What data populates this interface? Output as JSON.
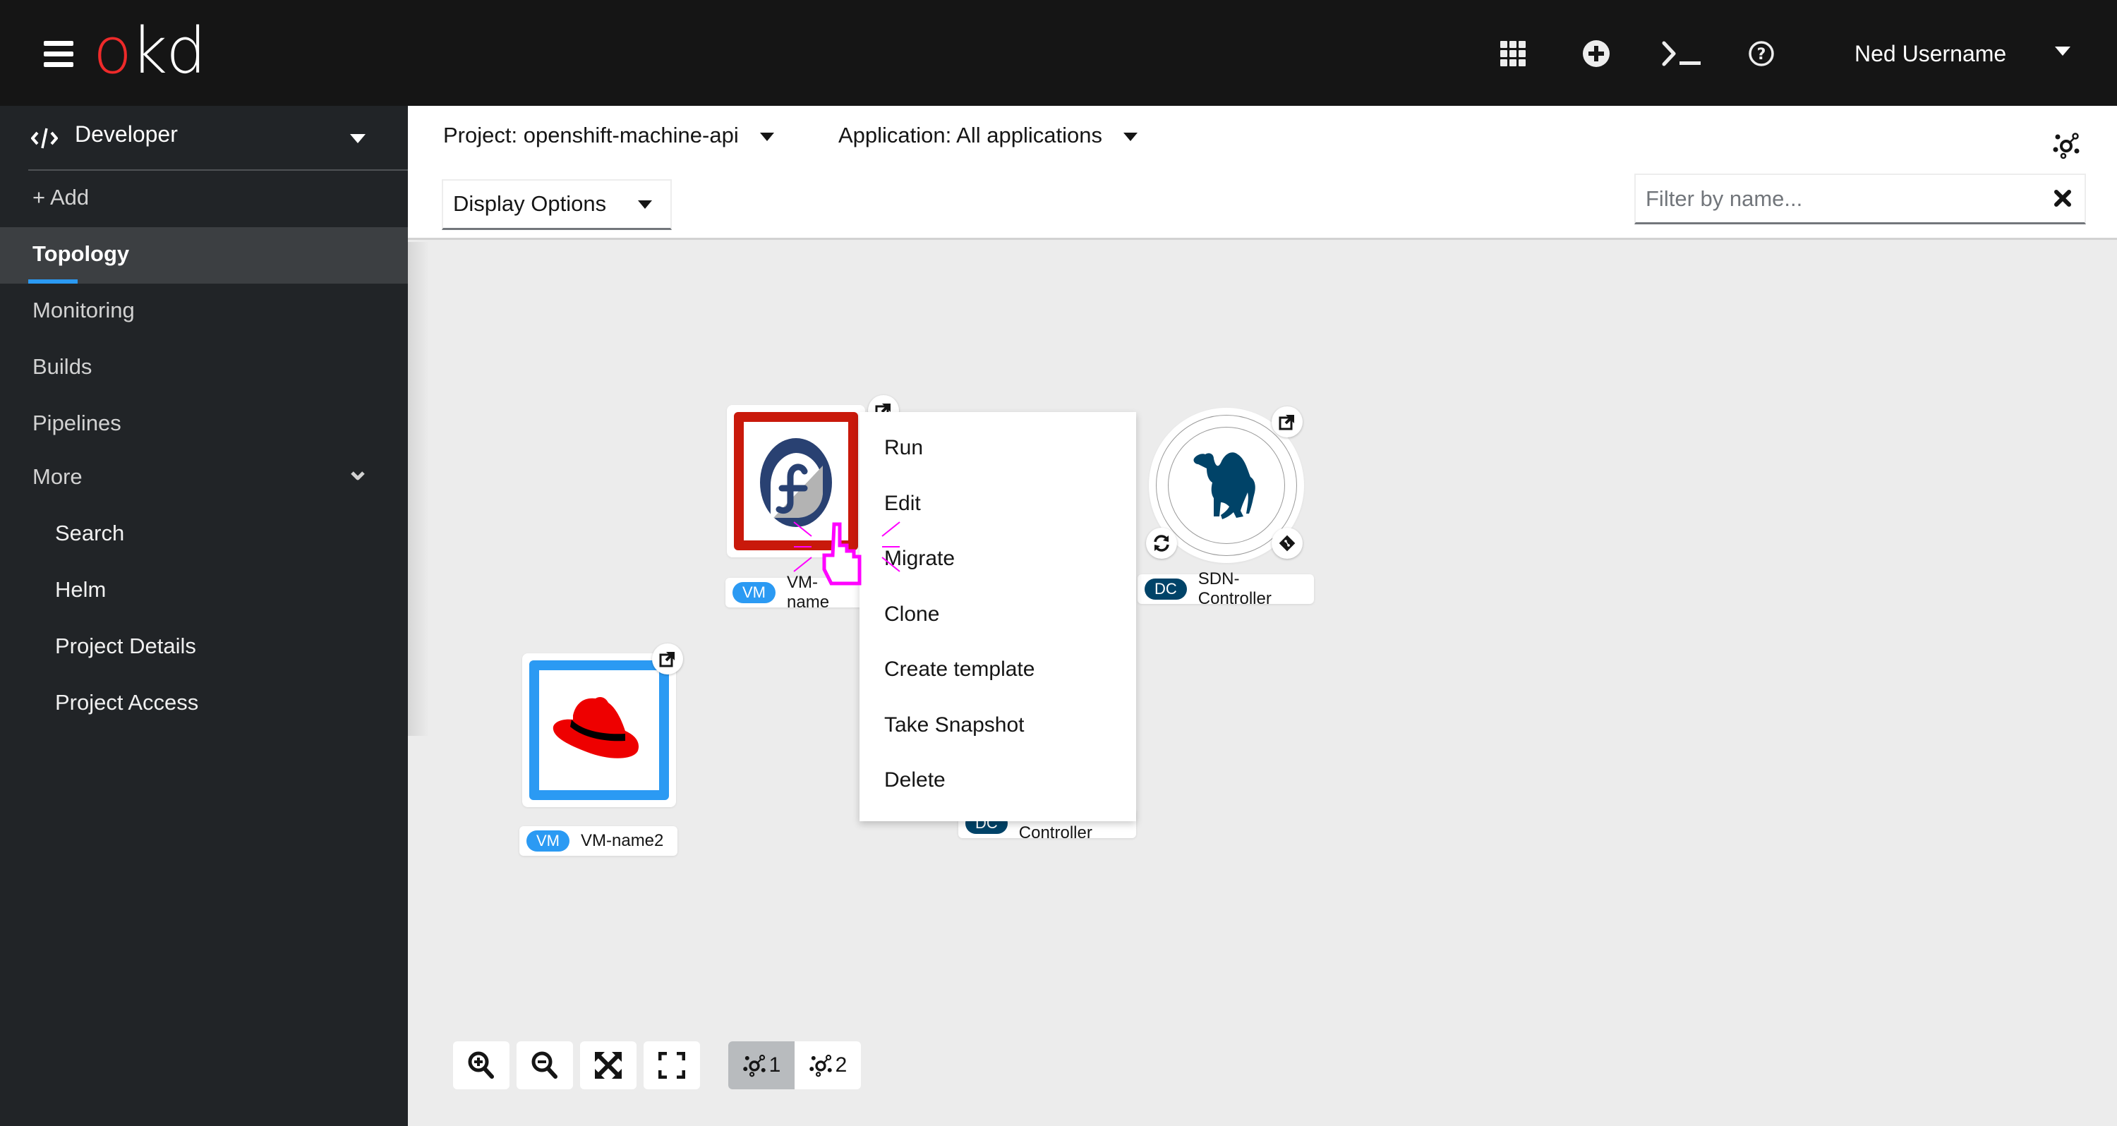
{
  "masthead": {
    "brand": {
      "o": "o",
      "rest": "kd"
    },
    "icons": [
      "app-launcher-icon",
      "add-icon",
      "terminal-icon",
      "help-icon"
    ],
    "user_name": "Ned Username"
  },
  "sidebar": {
    "perspective": {
      "label": "Developer",
      "icon": "code-icon"
    },
    "items": [
      {
        "label": "+ Add",
        "active": false
      },
      {
        "label": "Topology",
        "active": true
      },
      {
        "label": "Monitoring",
        "active": false
      },
      {
        "label": "Builds",
        "active": false
      },
      {
        "label": "Pipelines",
        "active": false
      },
      {
        "label": "More",
        "expanded": true
      }
    ],
    "more_items": [
      {
        "label": "Search"
      },
      {
        "label": "Helm"
      },
      {
        "label": "Project Details"
      },
      {
        "label": "Project Access"
      }
    ]
  },
  "toolbar": {
    "project_dropdown": "Project: openshift-machine-api",
    "application_dropdown": "Application: All applications",
    "display_options": "Display Options",
    "filter": {
      "placeholder": "Filter by name...",
      "value": ""
    }
  },
  "topology": {
    "nodes": [
      {
        "kind": "VM",
        "name": "VM-name",
        "icon": "fedora-icon",
        "frame_color": "#c9190b"
      },
      {
        "kind": "VM",
        "name": "VM-name2",
        "icon": "redhat-icon",
        "frame_color": "#2b9af3"
      },
      {
        "kind": "DC",
        "name": "SDN-Controller",
        "icon": "perl-camel-icon"
      },
      {
        "kind": "DC",
        "name": "SDN-Controller"
      }
    ],
    "badge_colors": {
      "VM": "#2b9af3",
      "DC": "#004368"
    }
  },
  "context_menu": {
    "items": [
      "Run",
      "Edit",
      "Migrate",
      "Clone",
      "Create template",
      "Take Snapshot",
      "Delete"
    ]
  },
  "controls": {
    "buttons": [
      "zoom-in",
      "zoom-out",
      "fit-to-screen",
      "reset-view"
    ],
    "layouts": [
      {
        "label": "1",
        "active": true
      },
      {
        "label": "2",
        "active": false
      }
    ]
  }
}
